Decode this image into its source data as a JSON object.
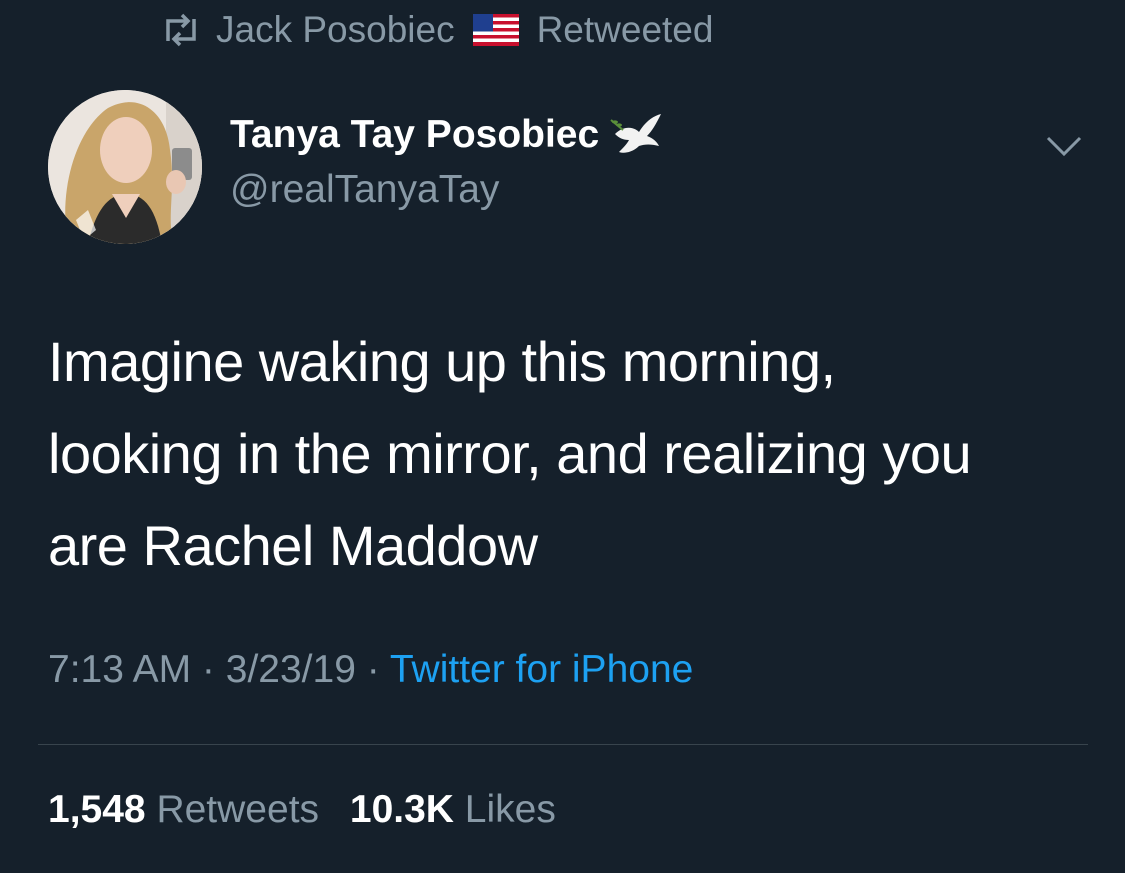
{
  "retweet_context": {
    "icon": "retweet-icon",
    "retweeter_name": "Jack Posobiec",
    "flag_icon": "us-flag-icon",
    "label": "Retweeted"
  },
  "author": {
    "display_name": "Tanya Tay Posobiec",
    "handle": "@realTanyaTay",
    "name_emoji_icon": "dove-icon"
  },
  "tweet": {
    "lines": [
      "Imagine waking up this morning,",
      "looking in the mirror, and realizing you",
      "are Rachel Maddow"
    ]
  },
  "meta": {
    "time": "7:13 AM",
    "separator1": " · ",
    "date": "3/23/19",
    "separator2": " · ",
    "source": "Twitter for iPhone"
  },
  "stats": {
    "retweets_count": "1,548",
    "retweets_label": "Retweets",
    "likes_count": "10.3K",
    "likes_label": "Likes"
  },
  "colors": {
    "background": "#15202b",
    "primary_text": "#ffffff",
    "secondary_text": "#8899a6",
    "link": "#1da1f2",
    "divider": "#38444d"
  }
}
